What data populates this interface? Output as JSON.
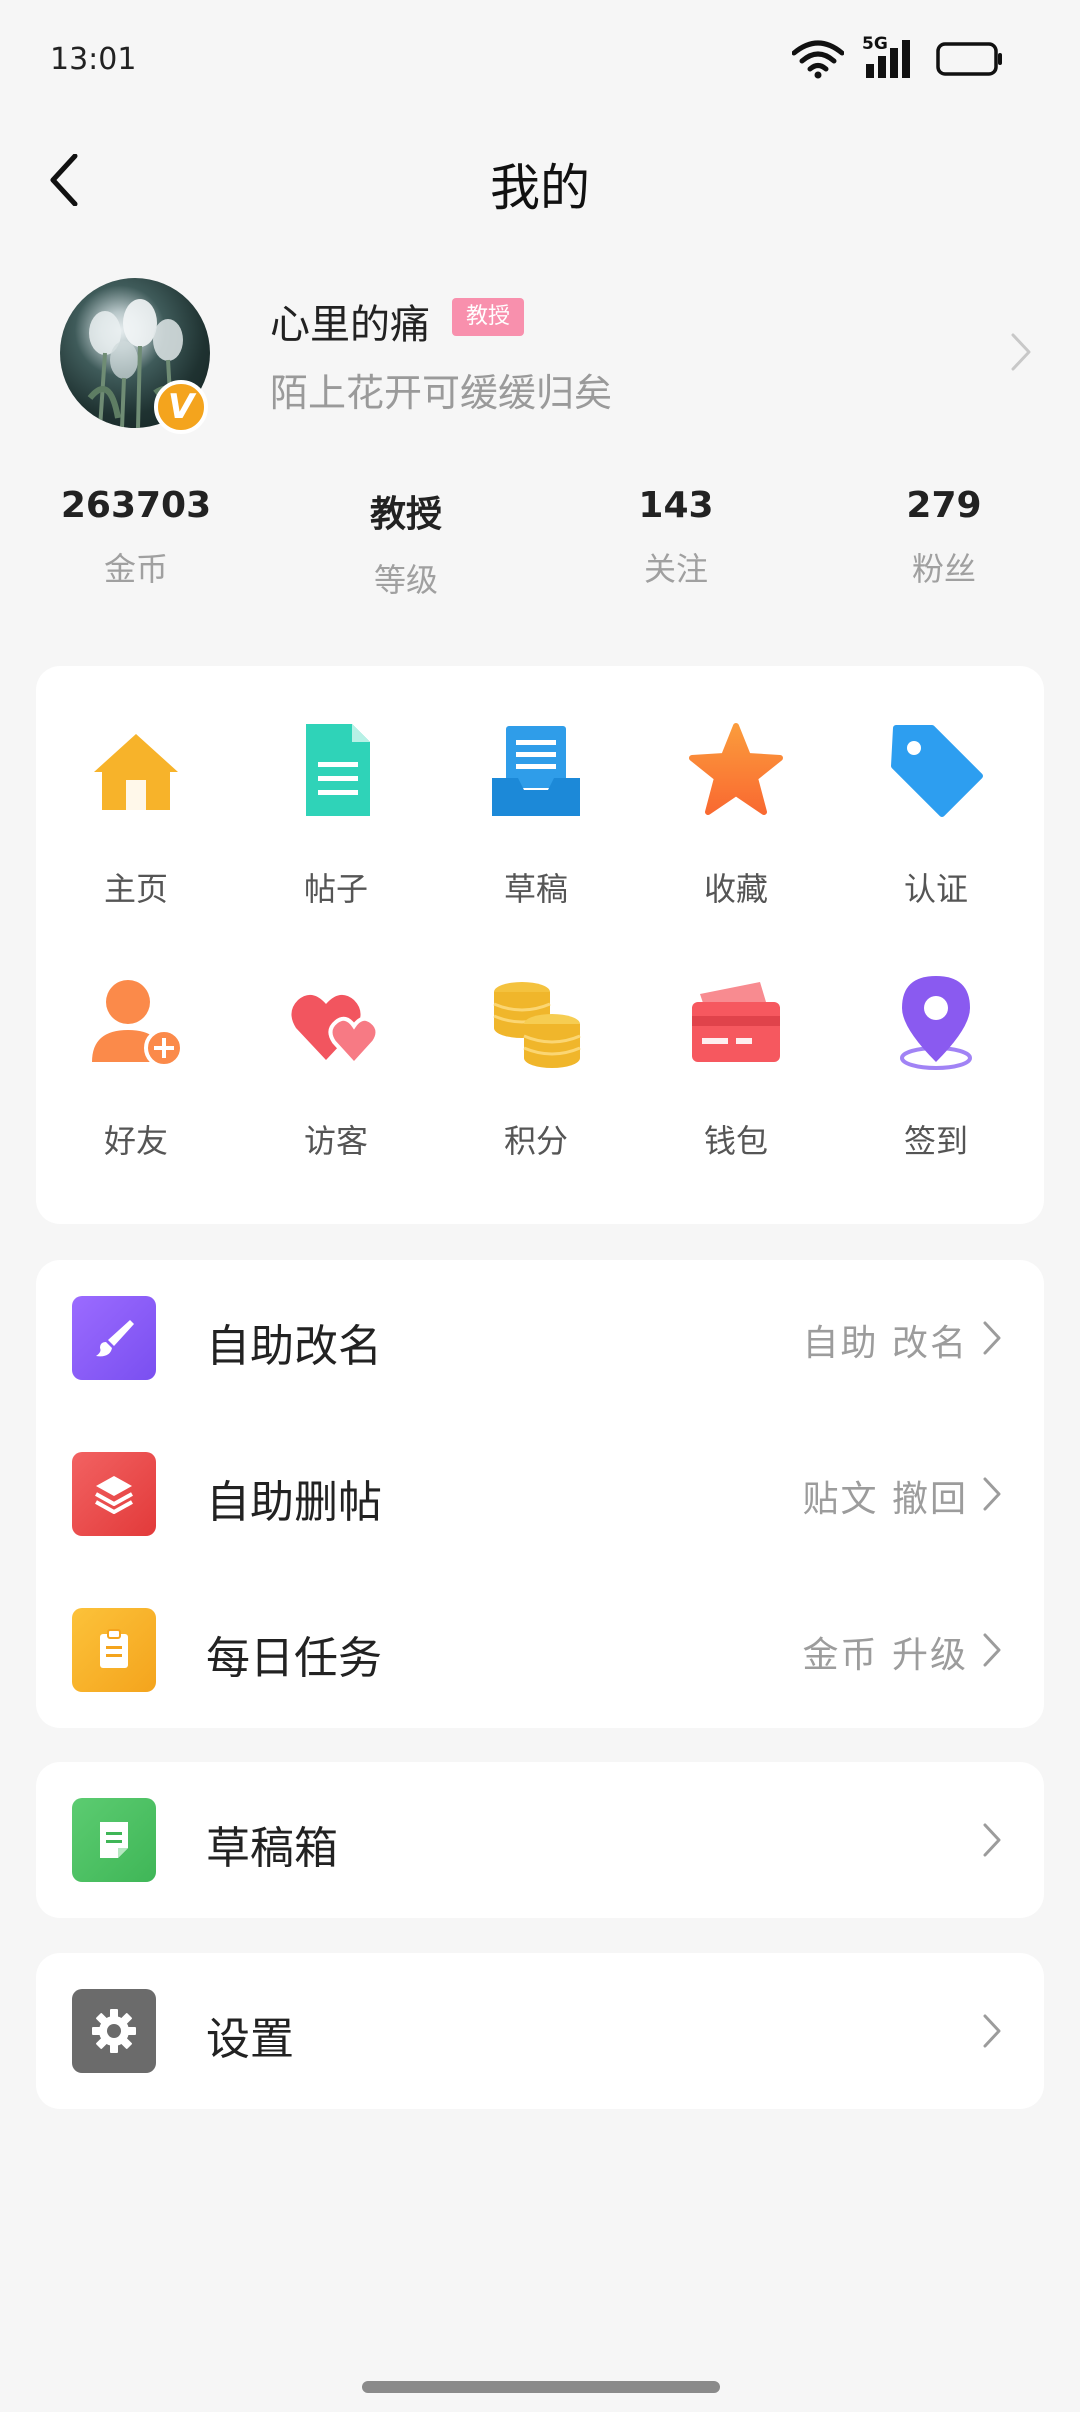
{
  "status_bar": {
    "time": "13:01",
    "network": "5G"
  },
  "nav": {
    "title": "我的"
  },
  "profile": {
    "name": "心里的痛",
    "level_tag": "教授",
    "signature": "陌上花开可缓缓归矣",
    "badge": "V"
  },
  "stats": [
    {
      "value": "263703",
      "label": "金币"
    },
    {
      "value": "教授",
      "label": "等级"
    },
    {
      "value": "143",
      "label": "关注"
    },
    {
      "value": "279",
      "label": "粉丝"
    }
  ],
  "grid": [
    {
      "label": "主页",
      "icon": "home-icon",
      "color": "#f7b32a"
    },
    {
      "label": "帖子",
      "icon": "document-icon",
      "color": "#2fd3b8"
    },
    {
      "label": "草稿",
      "icon": "draft-tray-icon",
      "color": "#2f9de9"
    },
    {
      "label": "收藏",
      "icon": "star-icon",
      "color": "#fb7a32"
    },
    {
      "label": "认证",
      "icon": "tag-icon",
      "color": "#2d9ef0"
    },
    {
      "label": "好友",
      "icon": "add-friend-icon",
      "color": "#fb8a4a"
    },
    {
      "label": "访客",
      "icon": "hearts-icon",
      "color": "#f2555f"
    },
    {
      "label": "积分",
      "icon": "coins-icon",
      "color": "#f4c23e"
    },
    {
      "label": "钱包",
      "icon": "wallet-card-icon",
      "color": "#f6585f"
    },
    {
      "label": "签到",
      "icon": "location-pin-icon",
      "color": "#8a5af0"
    }
  ],
  "list": [
    {
      "title": "自助改名",
      "meta": "自助 改名",
      "icon": "paintbrush-icon",
      "color": "#8b5cf6"
    },
    {
      "title": "自助删帖",
      "meta": "贴文 撤回",
      "icon": "layers-icon",
      "color": "#ef4444"
    },
    {
      "title": "每日任务",
      "meta": "金币 升级",
      "icon": "clipboard-icon",
      "color": "#f7b325"
    },
    {
      "title": "草稿箱",
      "meta": "",
      "icon": "note-icon",
      "color": "#4cbf63"
    },
    {
      "title": "设置",
      "meta": "",
      "icon": "gear-icon",
      "color": "#6b6b6b"
    }
  ]
}
